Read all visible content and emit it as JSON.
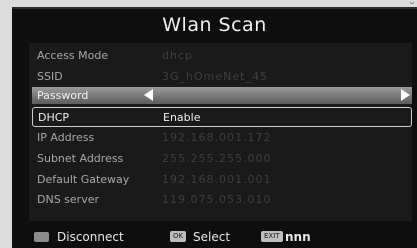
{
  "screen": {
    "title": "Wlan Scan"
  },
  "rows": [
    {
      "label": "Access Mode",
      "value": "dhcp"
    },
    {
      "label": "SSID",
      "value": "3G_hOmeNet_45"
    },
    {
      "label": "Password",
      "value": ""
    },
    {
      "label": "DHCP",
      "value": "Enable"
    },
    {
      "label": "IP Address",
      "value": "192.168.001.172"
    },
    {
      "label": "Subnet Address",
      "value": "255.255.255.000"
    },
    {
      "label": "Default Gateway",
      "value": "192.168.001.001"
    },
    {
      "label": "DNS server",
      "value": "119.075.053.010"
    }
  ],
  "footer": {
    "disconnect_label": "Disconnect",
    "ok_key": "OK",
    "select_label": "Select",
    "exit_key": "EXIT",
    "exit_label": "nnn"
  },
  "corner_mark": "ᴗ"
}
